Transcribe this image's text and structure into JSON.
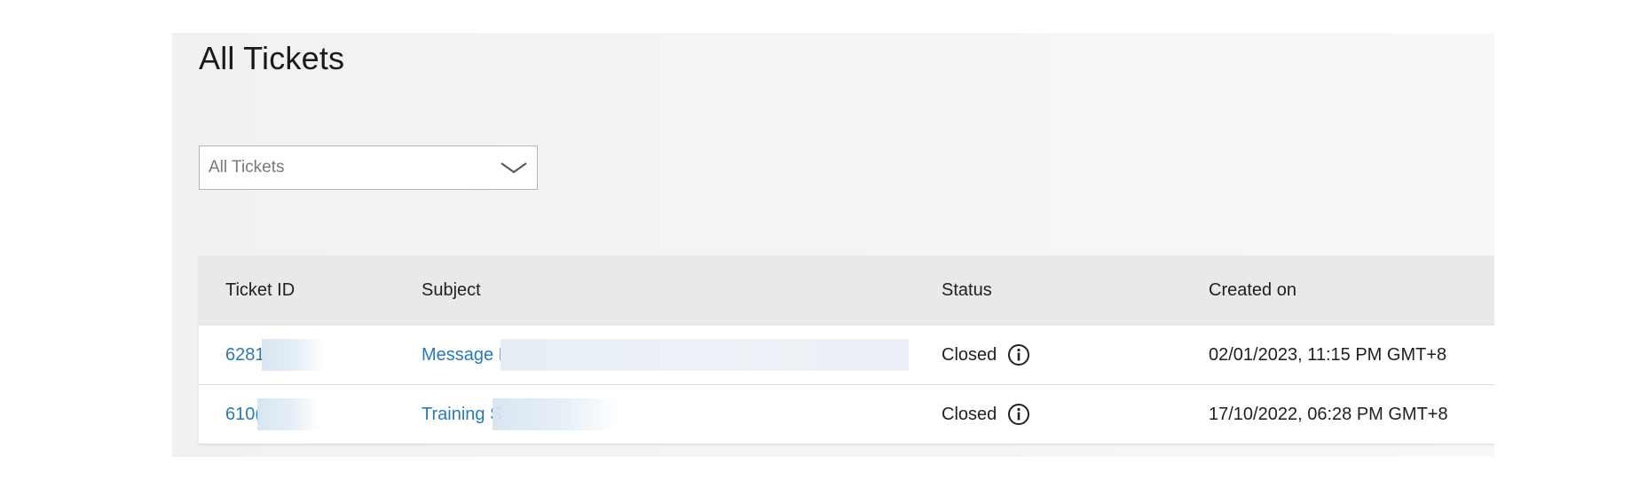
{
  "page": {
    "title": "All Tickets"
  },
  "filter": {
    "selected": "All Tickets"
  },
  "table": {
    "columns": [
      "Ticket ID",
      "Subject",
      "Status",
      "Created on"
    ],
    "rows": [
      {
        "id": "6281",
        "subject": "Message F",
        "status": "Closed",
        "created": "02/01/2023, 11:15 PM GMT+8"
      },
      {
        "id": "610(",
        "subject": "Training S",
        "status": "Closed",
        "created": "17/10/2022, 06:28 PM GMT+8"
      }
    ]
  },
  "colors": {
    "link": "#2a7ab0",
    "header_bg": "#e9e9e9",
    "panel_bg": "#f3f3f3"
  },
  "icons": {
    "filter_toggle": "chevron-down-icon",
    "status_info": "info-icon"
  }
}
